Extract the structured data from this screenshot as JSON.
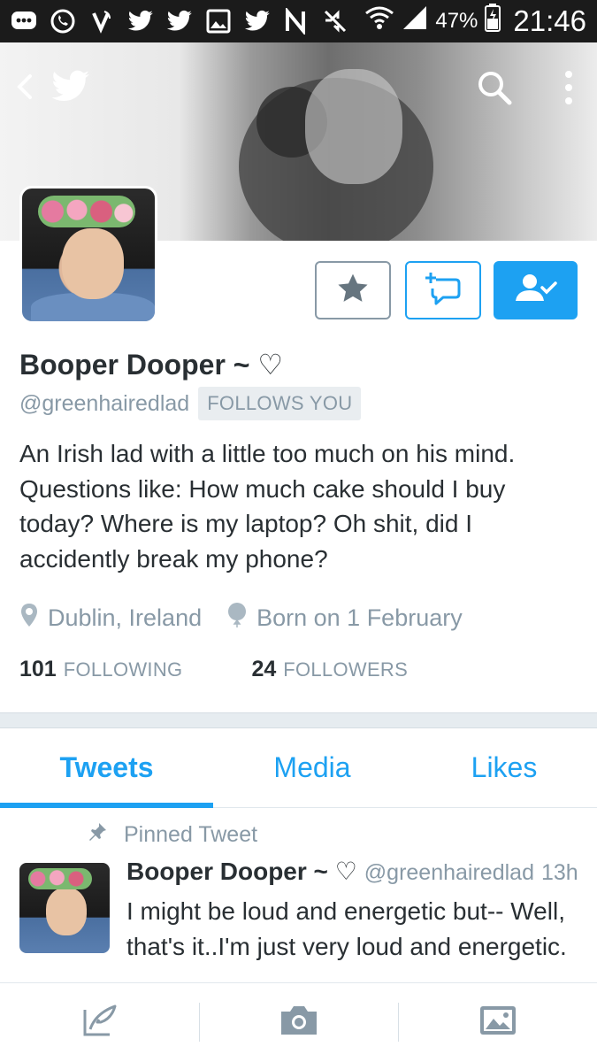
{
  "status_bar": {
    "battery_percent": "47%",
    "time": "21:46",
    "icons": [
      "messages-icon",
      "whatsapp-icon",
      "viber-icon",
      "twitter-icon",
      "twitter-icon",
      "gallery-icon",
      "twitter-icon",
      "nfc-icon",
      "mute-icon",
      "wifi-icon",
      "signal-icon",
      "battery-icon"
    ]
  },
  "header": {
    "back_icon": "back-chevron-icon",
    "logo_icon": "twitter-bird-icon",
    "search_icon": "search-icon",
    "menu_icon": "overflow-menu-icon"
  },
  "profile": {
    "display_name": "Booper Dooper ~ ♡",
    "handle": "@greenhairedlad",
    "follows_you": "FOLLOWS YOU",
    "bio": "An Irish lad with a little too much on his mind. Questions like: How much cake should I buy today? Where is my laptop? Oh shit, did I accidently break my phone?",
    "location": "Dublin, Ireland",
    "birthday": "Born on 1 February",
    "following_count": "101",
    "following_label": "FOLLOWING",
    "followers_count": "24",
    "followers_label": "FOLLOWERS"
  },
  "actions": {
    "star_icon": "star-icon",
    "message_icon": "new-message-icon",
    "follow_icon": "following-person-check-icon"
  },
  "tabs": [
    {
      "label": "Tweets",
      "active": true
    },
    {
      "label": "Media",
      "active": false
    },
    {
      "label": "Likes",
      "active": false
    }
  ],
  "pinned_tweet": {
    "pinned_label": "Pinned Tweet",
    "name": "Booper Dooper ~ ♡",
    "handle": "@greenhairedlad",
    "time": "13h",
    "text": "I might be loud and energetic but-- Well, that's it..I'm just very loud and energetic."
  },
  "bottom_bar": {
    "items": [
      "compose-tweet-icon",
      "camera-icon",
      "image-gallery-icon"
    ]
  },
  "colors": {
    "accent": "#1da1f2",
    "muted_text": "#8899a6",
    "text": "#292f33",
    "status_bar_bg": "#1b1b1b"
  }
}
